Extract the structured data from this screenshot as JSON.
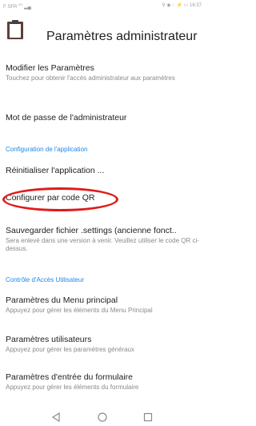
{
  "status_bar": {
    "carrier": "F SFR",
    "signal_text": "4G",
    "time": "16:37"
  },
  "app_bar": {
    "title": "Paramètres administrateur",
    "icon": "clipboard-icon"
  },
  "items": [
    {
      "title": "Modifier les Paramètres",
      "summary": "Touchez pour obtenir l'accès administrateur aux paramètres"
    },
    {
      "title": "Mot de passe de l'administrateur"
    },
    {
      "category": "Configuration de l'application"
    },
    {
      "title": "Réinitialiser l'application ..."
    },
    {
      "title": "Configurer par code QR"
    },
    {
      "title": "Sauvegarder fichier .settings (ancienne fonct..",
      "summary": "Sera enlevé dans une version à venir. Veuillez utiliser le code QR ci-dessus."
    },
    {
      "category": "Contrôle d'Accès Utilisateur"
    },
    {
      "title": "Paramètres du Menu principal",
      "summary": "Appuyez pour gérer les éléments du Menu Principal"
    },
    {
      "title": "Paramètres utilisateurs",
      "summary": "Appuyez pour gérer les paramètres généraux"
    },
    {
      "title": "Paramètres d'entrée du formulaire",
      "summary": "Appuyez pour gérer les éléments du formulaire"
    }
  ],
  "nav_bar": {
    "back": "back-triangle-icon",
    "home": "home-circle-icon",
    "recents": "recents-square-icon"
  },
  "colors": {
    "accent": "#1e88e5",
    "highlight": "#e01b1b"
  }
}
